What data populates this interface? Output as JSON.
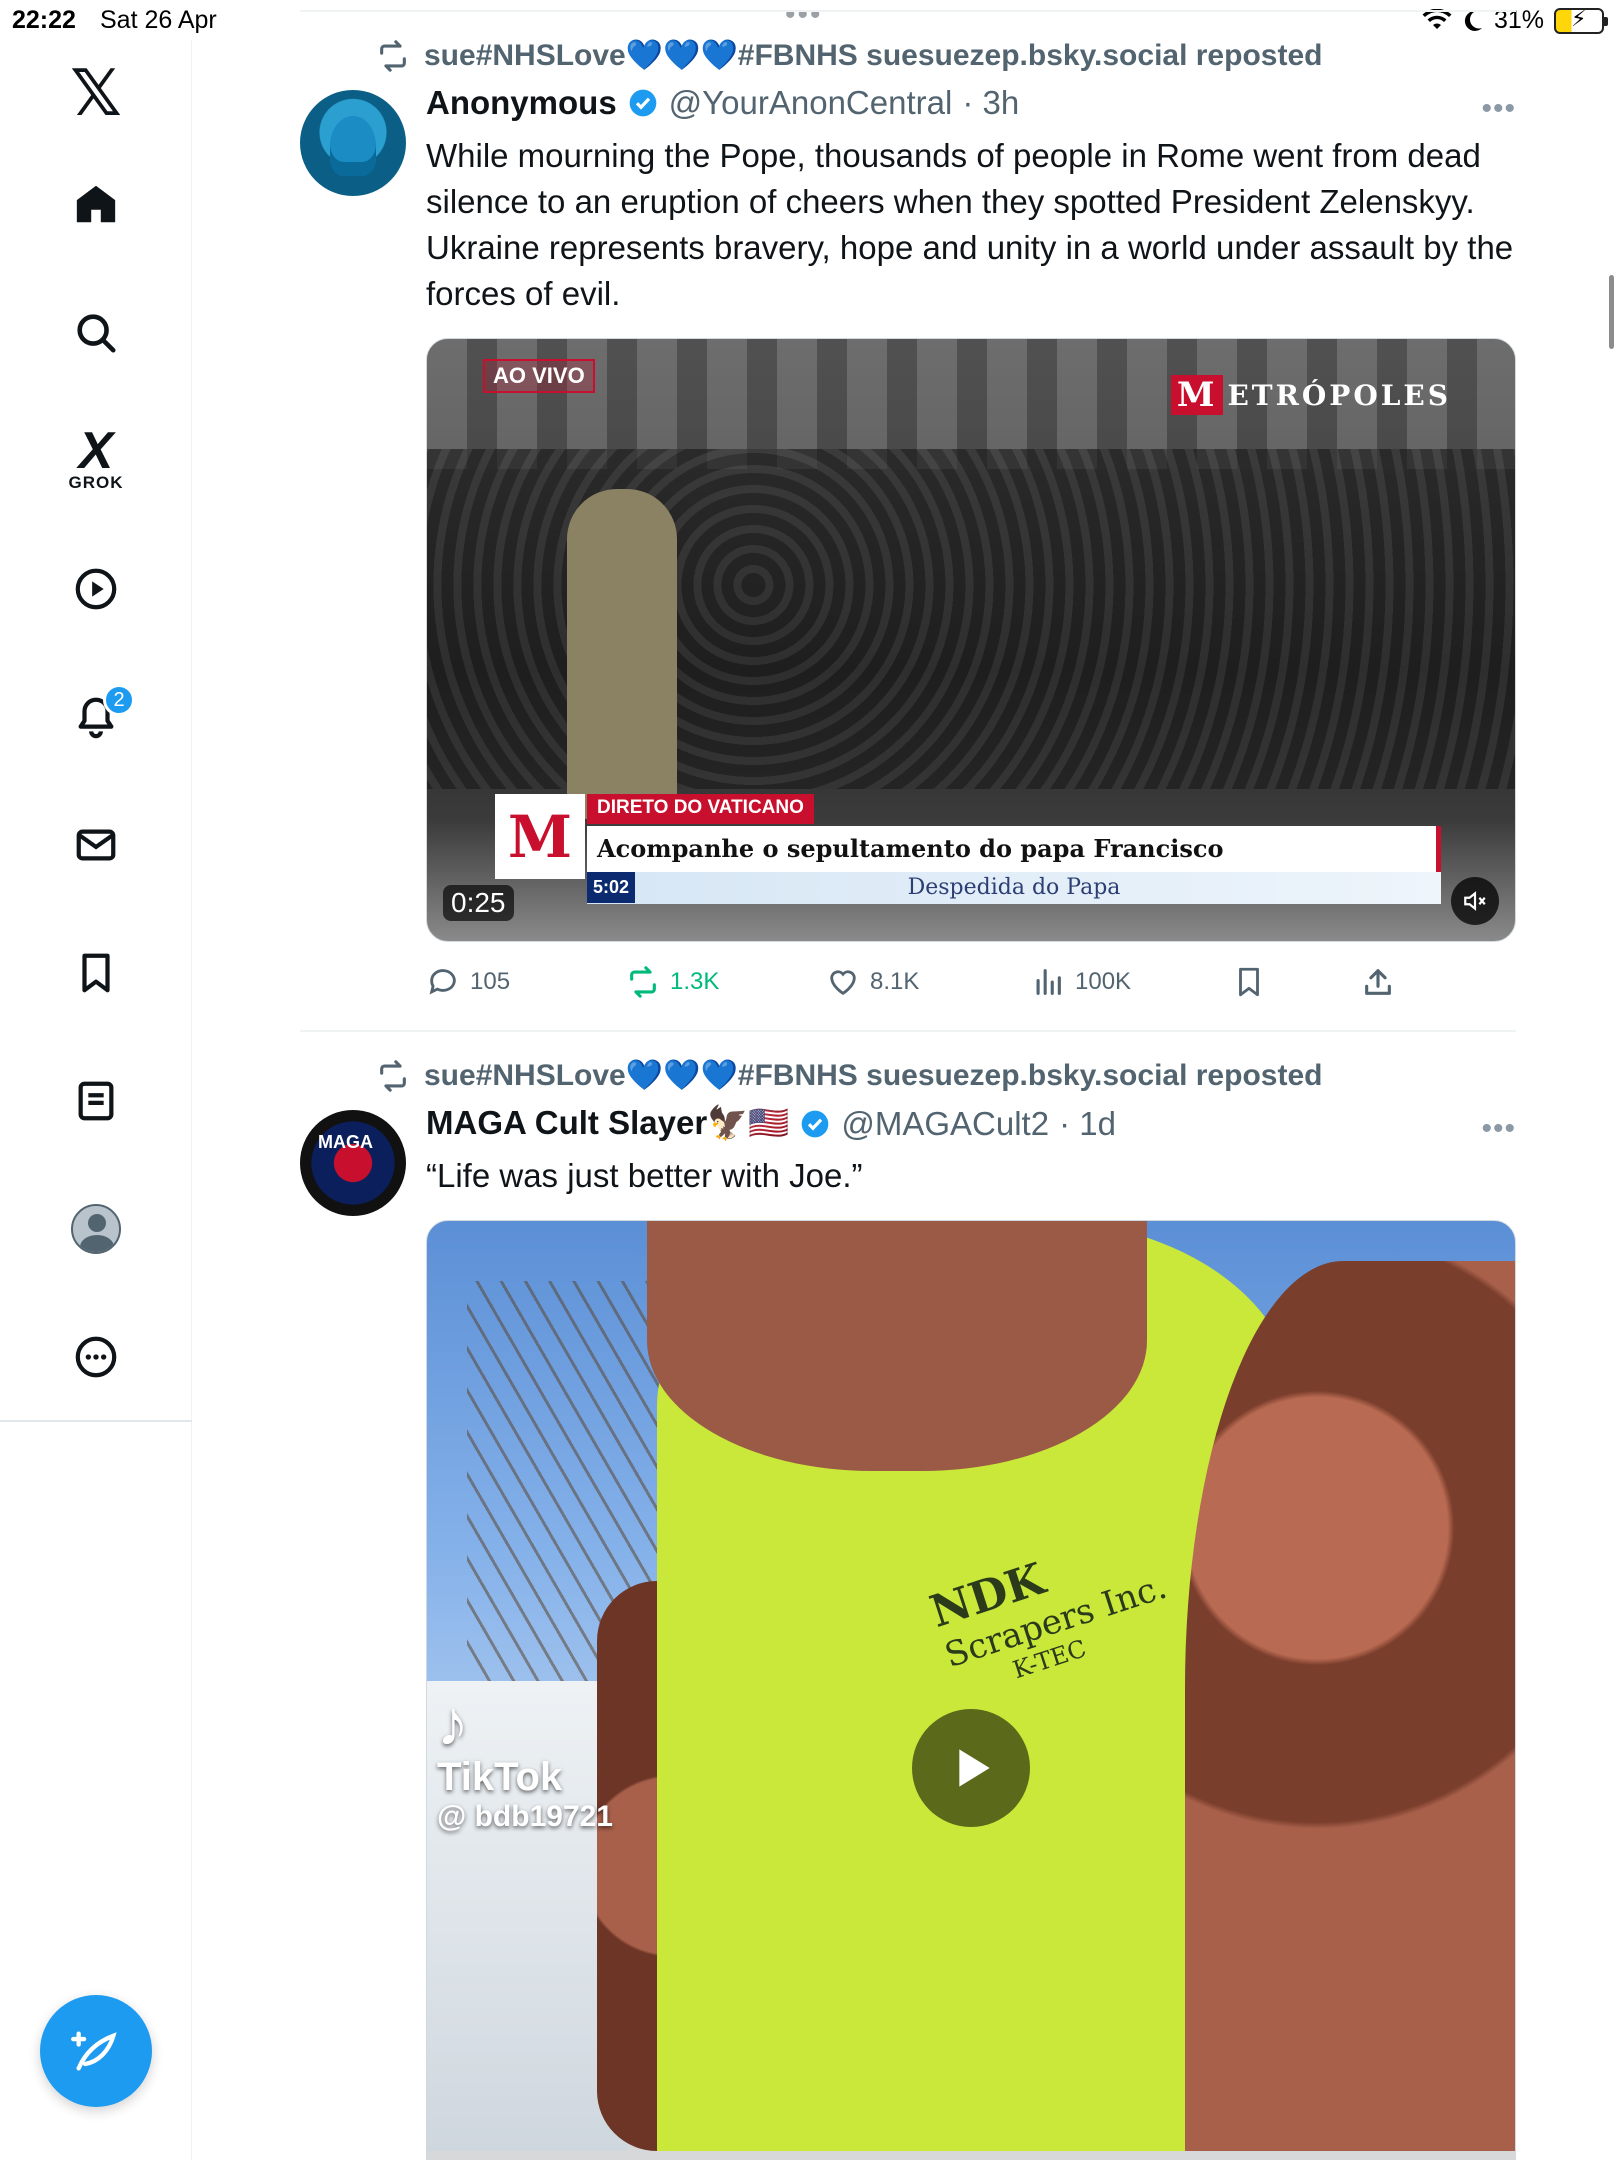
{
  "status_bar": {
    "time": "22:22",
    "date": "Sat 26 Apr",
    "battery": "31%"
  },
  "sidebar": {
    "grok_label": "GROK",
    "notification_count": "2",
    "items": [
      "Home",
      "Explore",
      "Grok",
      "Videos",
      "Notifications",
      "Messages",
      "Bookmarks",
      "Lists",
      "Profile",
      "More"
    ]
  },
  "tweets": [
    {
      "repost_by": "sue#NHSLove💙💙💙#FBNHS suesuezep.bsky.social reposted",
      "name": "Anonymous",
      "handle": "@YourAnonCentral",
      "time": "· 3h",
      "text": "While mourning the Pope, thousands of people in Rome went from dead silence to an eruption of cheers when they spotted President Zelenskyy. Ukraine represents bravery, hope and unity in a world under assault by the forces of evil.",
      "video": {
        "live_tag": "AO VIVO",
        "brand": "ETRÓPOLES",
        "brand_initial": "M",
        "kicker": "DIRETO DO VATICANO",
        "headline": "Acompanhe o sepultamento do papa Francisco",
        "subtitle": "Despedida do Papa",
        "clock": "5:02",
        "duration": "0:25"
      },
      "actions": {
        "replies": "105",
        "reposts": "1.3K",
        "likes": "8.1K",
        "views": "100K"
      }
    },
    {
      "repost_by": "sue#NHSLove💙💙💙#FBNHS suesuezep.bsky.social reposted",
      "name": "MAGA Cult Slayer🦅🇺🇸",
      "handle": "@MAGACult2",
      "time": "· 1d",
      "avatar_text": "MAGA",
      "text": "“Life was just better with Joe.”",
      "video": {
        "tiktok_label": "TikTok",
        "tiktok_user": "@ bdb19721",
        "shirt_brand": "NDK",
        "shirt_sub": "Scrapers Inc.",
        "shirt_sub2": "K-TEC"
      }
    }
  ]
}
